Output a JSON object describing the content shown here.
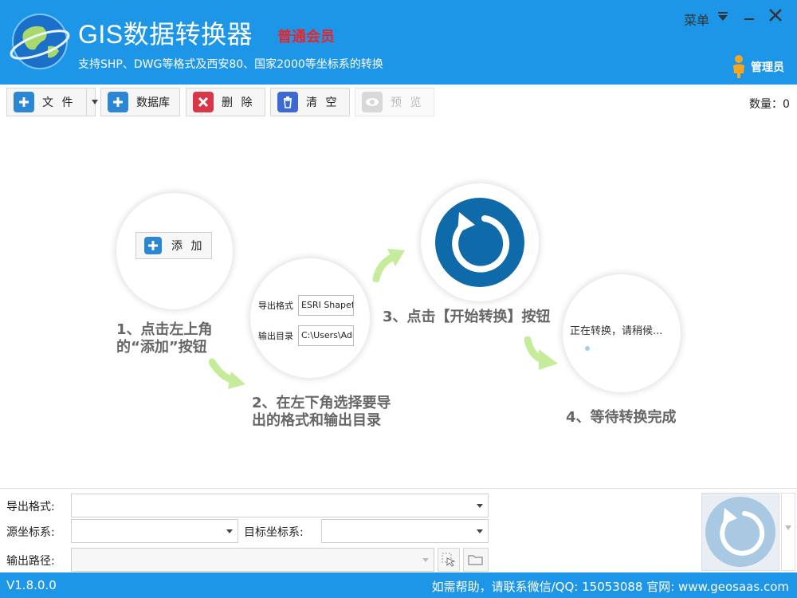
{
  "header": {
    "app_title": "GIS数据转换器",
    "member_level": "普通会员",
    "subtitle": "支持SHP、DWG等格式及西安80、国家2000等坐标系的转换",
    "menu_label": "菜单",
    "admin_label": "管理员",
    "bg_color": "#1e96e8",
    "member_color": "#e8242c"
  },
  "toolbar": {
    "file_label": "文 件",
    "database_label": "数据库",
    "delete_label": "删 除",
    "clear_label": "清 空",
    "preview_label": "预 览",
    "count_label": "数量：0"
  },
  "guide": {
    "add_button_label": "添 加",
    "step1_line1": "1、点击左上角",
    "step1_line2": "的“添加”按钮",
    "step2_line1": "2、在左下角选择要导",
    "step2_line2": "出的格式和输出目录",
    "step3": "3、点击【开始转换】按钮",
    "step4": "4、等待转换完成",
    "form_format_label": "导出格式",
    "form_format_value": "ESRI Shapefile",
    "form_dir_label": "输出目录",
    "form_dir_value": "C:\\Users\\Adm",
    "waiting_text": "正在转换，请稍候..."
  },
  "bottom": {
    "export_format_label": "导出格式:",
    "export_format_value": "",
    "source_crs_label": "源坐标系:",
    "source_crs_value": "",
    "target_crs_label": "目标坐标系:",
    "target_crs_value": "",
    "output_path_label": "输出路径:",
    "output_path_value": ""
  },
  "status": {
    "version": "V1.8.0.0",
    "help_text": "如需帮助，请联系微信/QQ:  15053088  官网:  www.geosaas.com"
  }
}
